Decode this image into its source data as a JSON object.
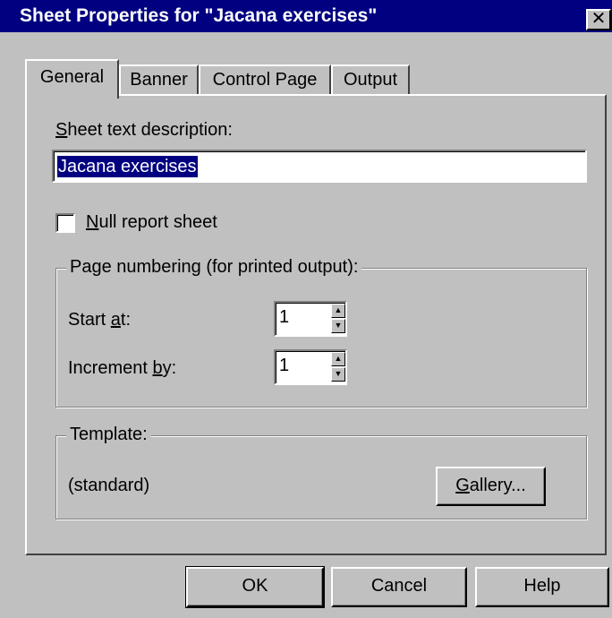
{
  "window": {
    "title": "Sheet Properties for \"Jacana exercises\"",
    "close_glyph": "✕"
  },
  "tabs": [
    {
      "label": "General",
      "active": true
    },
    {
      "label": "Banner",
      "active": false
    },
    {
      "label": "Control Page",
      "active": false
    },
    {
      "label": "Output",
      "active": false
    }
  ],
  "general": {
    "description_label_mnemonic": "S",
    "description_label_rest": "heet text description:",
    "description_value": "Jacana exercises",
    "null_report": {
      "mnemonic": "N",
      "rest": "ull report sheet",
      "checked": false
    },
    "page_numbering": {
      "legend": "Page numbering (for printed output):",
      "start_at": {
        "label_pre": "Start ",
        "mnemonic": "a",
        "label_post": "t:",
        "value": "1"
      },
      "increment_by": {
        "label_pre": "Increment ",
        "mnemonic": "b",
        "label_post": "y:",
        "value": "1"
      }
    },
    "template": {
      "legend": "Template:",
      "value": "(standard)",
      "gallery_mnemonic": "G",
      "gallery_rest": "allery..."
    }
  },
  "buttons": {
    "ok": "OK",
    "cancel": "Cancel",
    "help": "Help"
  },
  "icons": {
    "spin_up": "▲",
    "spin_down": "▼"
  }
}
